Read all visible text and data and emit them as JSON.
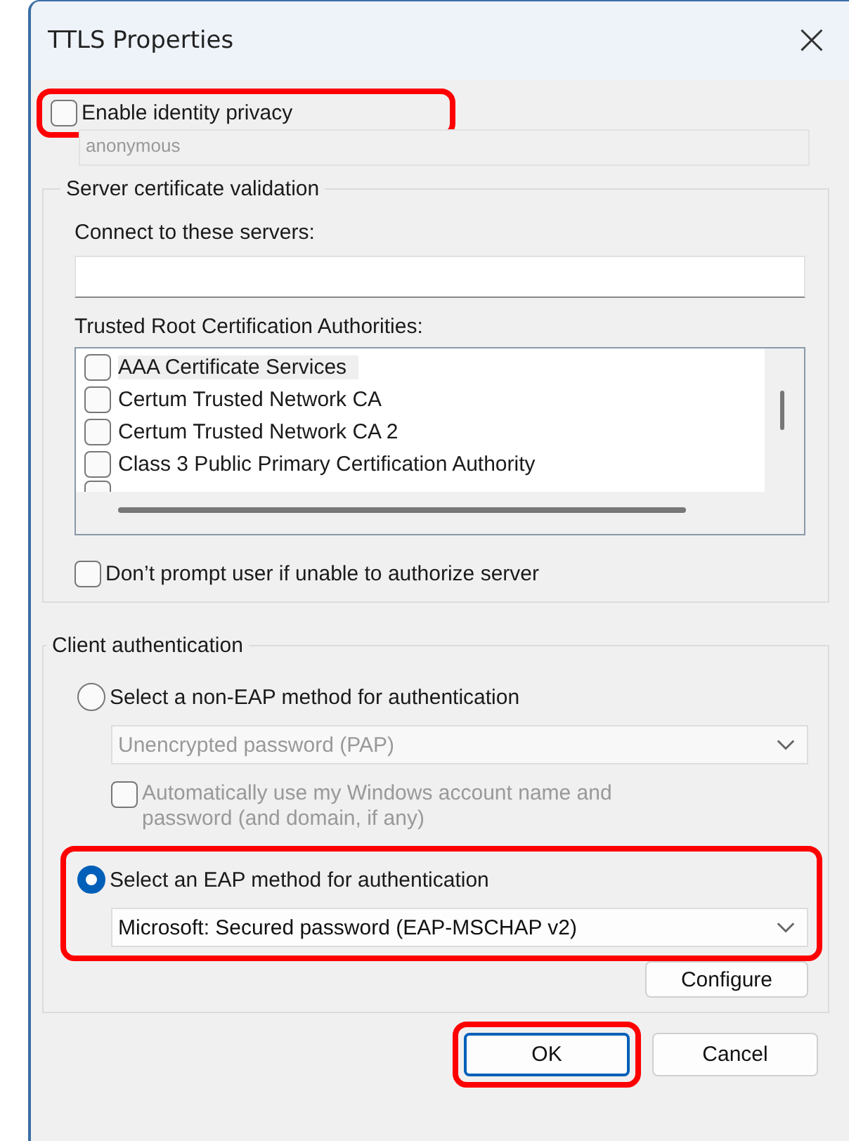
{
  "window": {
    "title": "TTLS Properties",
    "close": "×"
  },
  "identity_privacy": {
    "label": "Enable identity privacy",
    "checked": false,
    "highlighted": true,
    "field": {
      "value": "anonymous",
      "disabled": true
    }
  },
  "server_validation": {
    "title": "Server certificate validation",
    "servers_label": "Connect to these servers:",
    "servers_field": {
      "disabled": false
    },
    "authorities_label": "Trusted Root Certification Authorities:",
    "authorities": [
      {
        "label": "AAA Certificate Services",
        "checked": false,
        "selected": true
      },
      {
        "label": "Certum Trusted Network CA",
        "checked": false,
        "selected": false
      },
      {
        "label": "Certum Trusted Network CA 2",
        "checked": false,
        "selected": false
      },
      {
        "label": "Class 3 Public Primary Certification Authority",
        "checked": false,
        "selected": false
      }
    ],
    "partial_item": {
      "checked": false
    },
    "dont_prompt": {
      "label": "Don’t prompt user if unable to authorize server",
      "checked": false
    }
  },
  "client_auth": {
    "title": "Client authentication",
    "non_eap": {
      "label": "Select a non-EAP method for authentication",
      "selected": false,
      "highlighted": false,
      "dropdown": {
        "value": "Unencrypted password (PAP)",
        "disabled": true
      },
      "auto_windows": {
        "label": "Automatically use my Windows account name and password (and domain, if any)",
        "checked": false,
        "disabled": true
      }
    },
    "eap": {
      "label": "Select an EAP method for authentication",
      "selected": true,
      "highlighted": true,
      "dropdown": {
        "value": "Microsoft: Secured password (EAP-MSCHAP v2)",
        "disabled": false
      }
    },
    "configure": "Configure"
  },
  "buttons": [
    {
      "label": "OK",
      "default": true,
      "highlighted": true
    },
    {
      "label": "Cancel",
      "default": false,
      "highlighted": false
    }
  ]
}
